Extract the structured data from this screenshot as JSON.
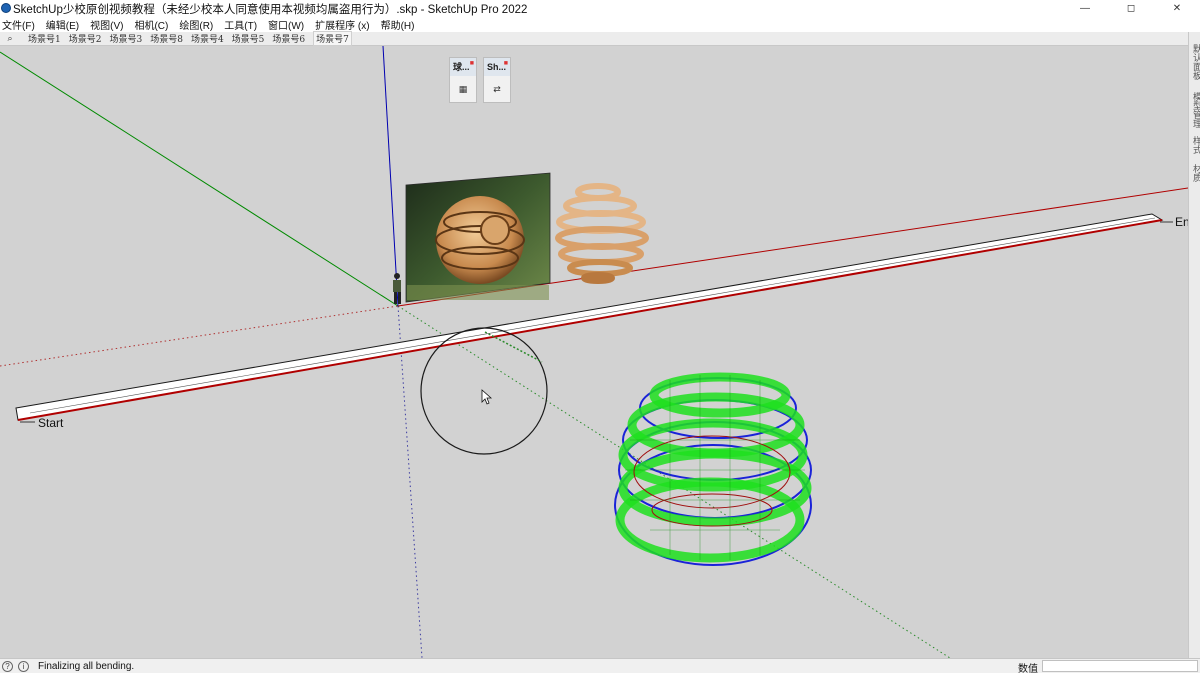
{
  "window": {
    "title": "SketchUp少校原创视频教程（未经少校本人同意使用本视频均属盗用行为）.skp - SketchUp Pro 2022",
    "controls": {
      "minimize": "—",
      "maximize": "◻",
      "close": "✕"
    }
  },
  "menu": [
    "文件(F)",
    "编辑(E)",
    "视图(V)",
    "相机(C)",
    "绘图(R)",
    "工具(T)",
    "窗口(W)",
    "扩展程序 (x)",
    "帮助(H)"
  ],
  "scenes": {
    "search_icon": "⌕",
    "tabs": [
      "场景号1",
      "场景号2",
      "场景号3",
      "场景号8",
      "场景号4",
      "场景号5",
      "场景号6",
      "场景号7"
    ],
    "active": "场景号7"
  },
  "tray_tabs": [
    "默认面板",
    "模型管理",
    "样式",
    "材质"
  ],
  "toolbars": [
    {
      "title": "球...",
      "icon": "sphere-tool-icon",
      "glyph": "▦"
    },
    {
      "title": "Sh...",
      "icon": "shape-bender-icon",
      "glyph": "⇄"
    }
  ],
  "scene_labels": {
    "start": "Start",
    "end": "En"
  },
  "statusbar": {
    "message": "Finalizing all bending.",
    "measurements_label": "数值",
    "measurements_value": ""
  },
  "colors": {
    "viewport_bg": "#d2d2d2",
    "red_axis": "#b00000",
    "green_axis": "#008a00",
    "blue_axis": "#0000b0",
    "wire_green": "#1fe01f",
    "wire_blue": "#1a23d8",
    "wood": "#e7b98a"
  }
}
